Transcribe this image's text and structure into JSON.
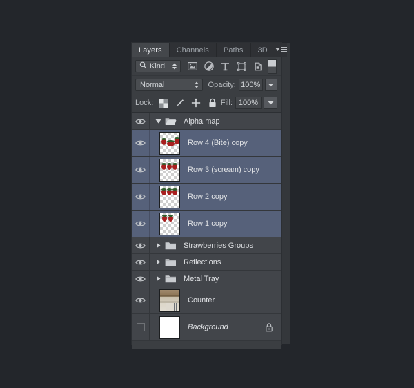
{
  "panel": {
    "tabs": [
      {
        "label": "Layers",
        "active": true
      },
      {
        "label": "Channels",
        "active": false
      },
      {
        "label": "Paths",
        "active": false
      },
      {
        "label": "3D",
        "active": false
      }
    ],
    "menu_icon": "panel-menu-icon"
  },
  "filter": {
    "search_icon": "search-icon",
    "kind_label": "Kind",
    "stepper_icon": "updown-stepper-icon",
    "icons": [
      "filter-pixel-layers-icon",
      "filter-adjustment-layers-icon",
      "filter-type-layers-icon",
      "filter-shape-layers-icon",
      "filter-smart-object-icon"
    ],
    "toggle_icon": "filter-enable-toggle"
  },
  "blend": {
    "mode": "Normal",
    "mode_stepper_icon": "updown-stepper-icon",
    "opacity_label": "Opacity:",
    "opacity_value": "100%",
    "opacity_dropdown_icon": "chevron-down-icon",
    "fill_label": "Fill:",
    "fill_value": "100%",
    "fill_dropdown_icon": "chevron-down-icon"
  },
  "lock": {
    "label": "Lock:",
    "icons": [
      "lock-transparent-pixels-icon",
      "lock-image-pixels-icon",
      "lock-position-icon",
      "lock-all-icon"
    ]
  },
  "layers": [
    {
      "name": "Alpha map",
      "type": "group",
      "visible": true,
      "expanded": true,
      "selected": false,
      "disclosure_icon": "triangle-down-icon",
      "folder_icon": "folder-open-icon",
      "eye_icon": "eye-icon"
    },
    {
      "name": "Row 4 (Bite) copy",
      "type": "layer",
      "visible": true,
      "selected": true,
      "thumbnail": "strawberries-bite-transparent",
      "eye_icon": "eye-icon"
    },
    {
      "name": "Row 3 (scream) copy",
      "type": "layer",
      "visible": true,
      "selected": true,
      "thumbnail": "strawberries-scream-transparent",
      "eye_icon": "eye-icon"
    },
    {
      "name": "Row 2 copy",
      "type": "layer",
      "visible": true,
      "selected": true,
      "thumbnail": "strawberries-row2-transparent",
      "eye_icon": "eye-icon"
    },
    {
      "name": "Row 1 copy",
      "type": "layer",
      "visible": true,
      "selected": true,
      "thumbnail": "strawberries-row1-transparent",
      "eye_icon": "eye-icon"
    },
    {
      "name": "Strawberries Groups",
      "type": "group",
      "visible": true,
      "expanded": false,
      "selected": false,
      "disclosure_icon": "triangle-right-icon",
      "folder_icon": "folder-closed-icon",
      "eye_icon": "eye-icon"
    },
    {
      "name": "Reflections",
      "type": "group",
      "visible": true,
      "expanded": false,
      "selected": false,
      "disclosure_icon": "triangle-right-icon",
      "folder_icon": "folder-closed-icon",
      "eye_icon": "eye-icon"
    },
    {
      "name": "Metal Tray",
      "type": "group",
      "visible": true,
      "expanded": false,
      "selected": false,
      "disclosure_icon": "triangle-right-icon",
      "folder_icon": "folder-closed-icon",
      "eye_icon": "eye-icon"
    },
    {
      "name": "Counter",
      "type": "layer",
      "visible": true,
      "selected": false,
      "thumbnail": "counter-photo",
      "eye_icon": "eye-icon"
    },
    {
      "name": "Background",
      "type": "layer",
      "visible": false,
      "selected": false,
      "italic": true,
      "locked": true,
      "thumbnail": "white-fill",
      "lock_icon": "lock-icon"
    }
  ],
  "colors": {
    "panel_bg": "#3b3e42",
    "row_bg": "#42454a",
    "row_selected": "#56617a",
    "app_bg": "#23262b",
    "tab_active": "#44474b",
    "text": "#dfe1e4"
  }
}
